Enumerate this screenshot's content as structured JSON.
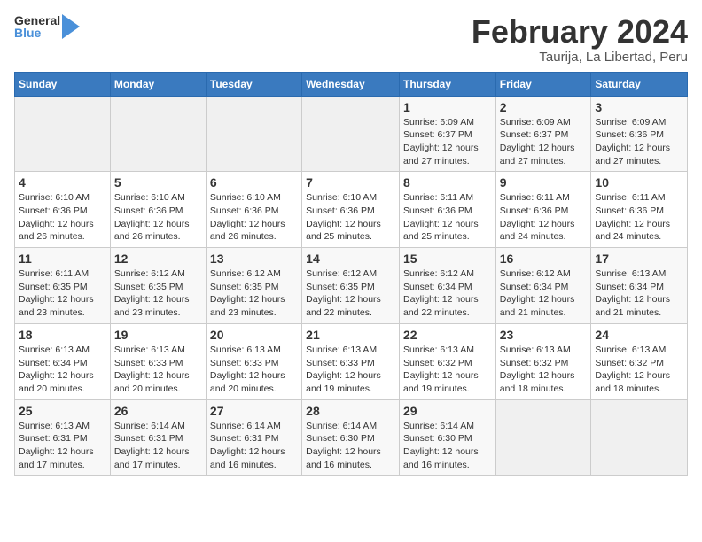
{
  "logo": {
    "text_general": "General",
    "text_blue": "Blue"
  },
  "header": {
    "title": "February 2024",
    "subtitle": "Taurija, La Libertad, Peru"
  },
  "days_of_week": [
    "Sunday",
    "Monday",
    "Tuesday",
    "Wednesday",
    "Thursday",
    "Friday",
    "Saturday"
  ],
  "weeks": [
    [
      {
        "day": "",
        "info": ""
      },
      {
        "day": "",
        "info": ""
      },
      {
        "day": "",
        "info": ""
      },
      {
        "day": "",
        "info": ""
      },
      {
        "day": "1",
        "info": "Sunrise: 6:09 AM\nSunset: 6:37 PM\nDaylight: 12 hours\nand 27 minutes."
      },
      {
        "day": "2",
        "info": "Sunrise: 6:09 AM\nSunset: 6:37 PM\nDaylight: 12 hours\nand 27 minutes."
      },
      {
        "day": "3",
        "info": "Sunrise: 6:09 AM\nSunset: 6:36 PM\nDaylight: 12 hours\nand 27 minutes."
      }
    ],
    [
      {
        "day": "4",
        "info": "Sunrise: 6:10 AM\nSunset: 6:36 PM\nDaylight: 12 hours\nand 26 minutes."
      },
      {
        "day": "5",
        "info": "Sunrise: 6:10 AM\nSunset: 6:36 PM\nDaylight: 12 hours\nand 26 minutes."
      },
      {
        "day": "6",
        "info": "Sunrise: 6:10 AM\nSunset: 6:36 PM\nDaylight: 12 hours\nand 26 minutes."
      },
      {
        "day": "7",
        "info": "Sunrise: 6:10 AM\nSunset: 6:36 PM\nDaylight: 12 hours\nand 25 minutes."
      },
      {
        "day": "8",
        "info": "Sunrise: 6:11 AM\nSunset: 6:36 PM\nDaylight: 12 hours\nand 25 minutes."
      },
      {
        "day": "9",
        "info": "Sunrise: 6:11 AM\nSunset: 6:36 PM\nDaylight: 12 hours\nand 24 minutes."
      },
      {
        "day": "10",
        "info": "Sunrise: 6:11 AM\nSunset: 6:36 PM\nDaylight: 12 hours\nand 24 minutes."
      }
    ],
    [
      {
        "day": "11",
        "info": "Sunrise: 6:11 AM\nSunset: 6:35 PM\nDaylight: 12 hours\nand 23 minutes."
      },
      {
        "day": "12",
        "info": "Sunrise: 6:12 AM\nSunset: 6:35 PM\nDaylight: 12 hours\nand 23 minutes."
      },
      {
        "day": "13",
        "info": "Sunrise: 6:12 AM\nSunset: 6:35 PM\nDaylight: 12 hours\nand 23 minutes."
      },
      {
        "day": "14",
        "info": "Sunrise: 6:12 AM\nSunset: 6:35 PM\nDaylight: 12 hours\nand 22 minutes."
      },
      {
        "day": "15",
        "info": "Sunrise: 6:12 AM\nSunset: 6:34 PM\nDaylight: 12 hours\nand 22 minutes."
      },
      {
        "day": "16",
        "info": "Sunrise: 6:12 AM\nSunset: 6:34 PM\nDaylight: 12 hours\nand 21 minutes."
      },
      {
        "day": "17",
        "info": "Sunrise: 6:13 AM\nSunset: 6:34 PM\nDaylight: 12 hours\nand 21 minutes."
      }
    ],
    [
      {
        "day": "18",
        "info": "Sunrise: 6:13 AM\nSunset: 6:34 PM\nDaylight: 12 hours\nand 20 minutes."
      },
      {
        "day": "19",
        "info": "Sunrise: 6:13 AM\nSunset: 6:33 PM\nDaylight: 12 hours\nand 20 minutes."
      },
      {
        "day": "20",
        "info": "Sunrise: 6:13 AM\nSunset: 6:33 PM\nDaylight: 12 hours\nand 20 minutes."
      },
      {
        "day": "21",
        "info": "Sunrise: 6:13 AM\nSunset: 6:33 PM\nDaylight: 12 hours\nand 19 minutes."
      },
      {
        "day": "22",
        "info": "Sunrise: 6:13 AM\nSunset: 6:32 PM\nDaylight: 12 hours\nand 19 minutes."
      },
      {
        "day": "23",
        "info": "Sunrise: 6:13 AM\nSunset: 6:32 PM\nDaylight: 12 hours\nand 18 minutes."
      },
      {
        "day": "24",
        "info": "Sunrise: 6:13 AM\nSunset: 6:32 PM\nDaylight: 12 hours\nand 18 minutes."
      }
    ],
    [
      {
        "day": "25",
        "info": "Sunrise: 6:13 AM\nSunset: 6:31 PM\nDaylight: 12 hours\nand 17 minutes."
      },
      {
        "day": "26",
        "info": "Sunrise: 6:14 AM\nSunset: 6:31 PM\nDaylight: 12 hours\nand 17 minutes."
      },
      {
        "day": "27",
        "info": "Sunrise: 6:14 AM\nSunset: 6:31 PM\nDaylight: 12 hours\nand 16 minutes."
      },
      {
        "day": "28",
        "info": "Sunrise: 6:14 AM\nSunset: 6:30 PM\nDaylight: 12 hours\nand 16 minutes."
      },
      {
        "day": "29",
        "info": "Sunrise: 6:14 AM\nSunset: 6:30 PM\nDaylight: 12 hours\nand 16 minutes."
      },
      {
        "day": "",
        "info": ""
      },
      {
        "day": "",
        "info": ""
      }
    ]
  ]
}
